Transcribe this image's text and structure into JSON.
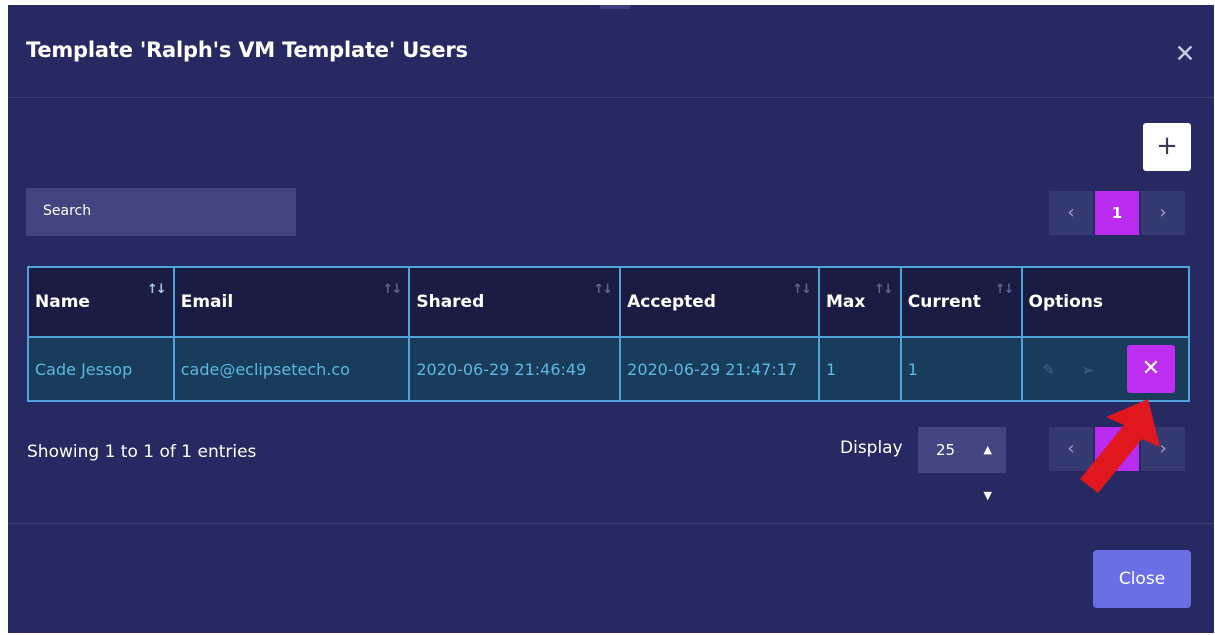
{
  "modal": {
    "title": "Template 'Ralph's VM Template' Users",
    "close_icon": "close-icon",
    "add_icon": "plus-icon",
    "add_label": "+"
  },
  "search": {
    "placeholder": "Search"
  },
  "pagination": {
    "prev_label": "‹",
    "current_page": "1",
    "next_label": "›"
  },
  "table": {
    "columns": [
      "Name",
      "Email",
      "Shared",
      "Accepted",
      "Max",
      "Current",
      "Options"
    ],
    "rows": [
      {
        "name": "Cade Jessop",
        "email": "cade@eclipsetech.co",
        "shared": "2020-06-29 21:46:49",
        "accepted": "2020-06-29 21:47:17",
        "max": "1",
        "current": "1"
      }
    ],
    "option_icons": [
      "edit-icon",
      "send-icon",
      "delete-icon"
    ]
  },
  "footer": {
    "showing": "Showing 1 to 1 of 1 entries",
    "display_label": "Display",
    "display_value": "25",
    "close_label": "Close"
  },
  "colors": {
    "modal_bg": "#272a62",
    "accent_magenta": "#bd2ef0",
    "close_button": "#6a6fe6",
    "table_border": "#4fa3d9",
    "annotation_arrow": "#e0171f"
  }
}
